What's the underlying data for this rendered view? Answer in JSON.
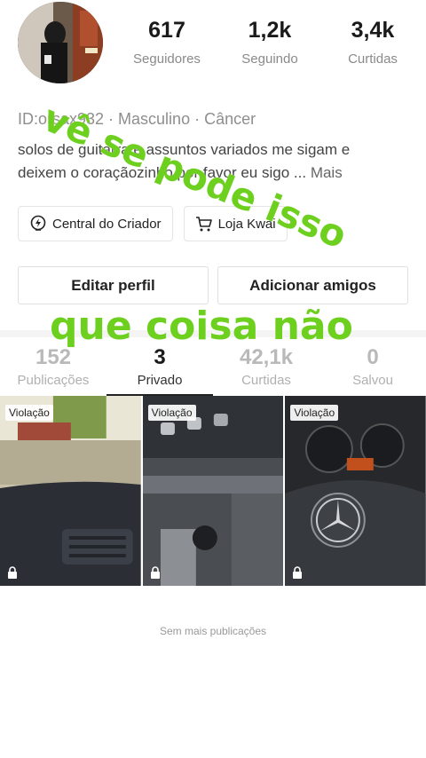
{
  "profile": {
    "followers_count": "617",
    "followers_label": "Seguidores",
    "following_count": "1,2k",
    "following_label": "Seguindo",
    "likes_count": "3,4k",
    "likes_label": "Curtidas",
    "meta_line": "ID:orsax932 · Masculino · Câncer",
    "bio_line1": "solos de guitarra e assuntos variados me sigam e",
    "bio_line2": "deixem o coraçãozinho por favor eu sigo ...",
    "bio_more": "Mais"
  },
  "chips": {
    "creator_center": "Central do Criador",
    "kwai_shop": "Loja Kwai"
  },
  "actions": {
    "edit_profile": "Editar perfil",
    "add_friends": "Adicionar amigos"
  },
  "tabs": [
    {
      "count": "152",
      "label": "Publicações"
    },
    {
      "count": "3",
      "label": "Privado"
    },
    {
      "count": "42,1k",
      "label": "Curtidas"
    },
    {
      "count": "0",
      "label": "Salvou"
    }
  ],
  "grid": {
    "badge_label": "Violação",
    "items": [
      {
        "badge": "Violação",
        "icon": "lock-icon"
      },
      {
        "badge": "Violação",
        "icon": "lock-icon"
      },
      {
        "badge": "Violação",
        "icon": "lock-icon"
      }
    ]
  },
  "footer": {
    "no_more_posts": "Sem mais publicações"
  },
  "overlay": {
    "caption_top": "vê se pode isso",
    "caption_middle": "que coisa não"
  },
  "colors": {
    "overlay_green": "#6dd01e",
    "active_tab_underline": "#222222"
  }
}
